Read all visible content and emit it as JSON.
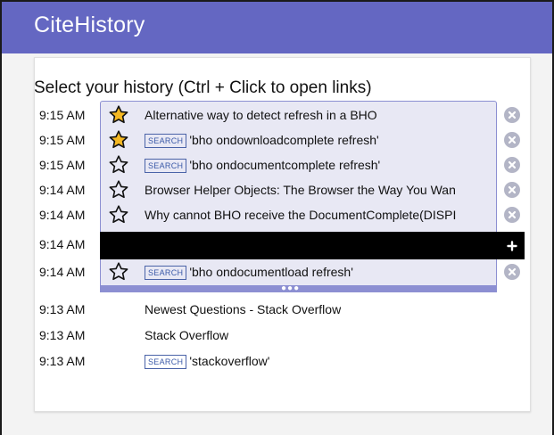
{
  "app": {
    "title": "CiteHistory"
  },
  "heading": "Select your history (Ctrl + Click to open links)",
  "tag_label": "SEARCH",
  "selected_rows": [
    {
      "time": "9:15 AM",
      "starred": true,
      "search": false,
      "text": "Alternative way to detect refresh in a BHO"
    },
    {
      "time": "9:15 AM",
      "starred": true,
      "search": true,
      "text": "'bho ondownloadcomplete refresh'"
    },
    {
      "time": "9:15 AM",
      "starred": false,
      "search": true,
      "text": "'bho ondocumentcomplete refresh'"
    },
    {
      "time": "9:14 AM",
      "starred": false,
      "search": false,
      "text": "Browser Helper Objects: The Browser the Way You Wan"
    },
    {
      "time": "9:14 AM",
      "starred": false,
      "search": false,
      "text": "Why cannot BHO receive the DocumentComplete(DISPI"
    },
    {
      "time": "9:14 AM",
      "starred": null,
      "search": false,
      "text": ""
    },
    {
      "time": "9:14 AM",
      "starred": false,
      "search": true,
      "text": "'bho ondocumentload refresh'"
    }
  ],
  "other_rows": [
    {
      "time": "9:13 AM",
      "search": false,
      "text": "Newest Questions - Stack Overflow"
    },
    {
      "time": "9:13 AM",
      "search": false,
      "text": "Stack Overflow"
    },
    {
      "time": "9:13 AM",
      "search": true,
      "text": "'stackoverflow'"
    }
  ],
  "colors": {
    "header": "#6467c2",
    "selection_bg": "#e8e8f4",
    "selection_border": "#8c8fd2",
    "star_gold": "#f5b823",
    "search_tag": "#3b5aa8"
  },
  "icons": {
    "star": "star-icon",
    "remove": "remove-circle-icon",
    "add": "add-circle-icon",
    "more": "more-dots-icon"
  }
}
